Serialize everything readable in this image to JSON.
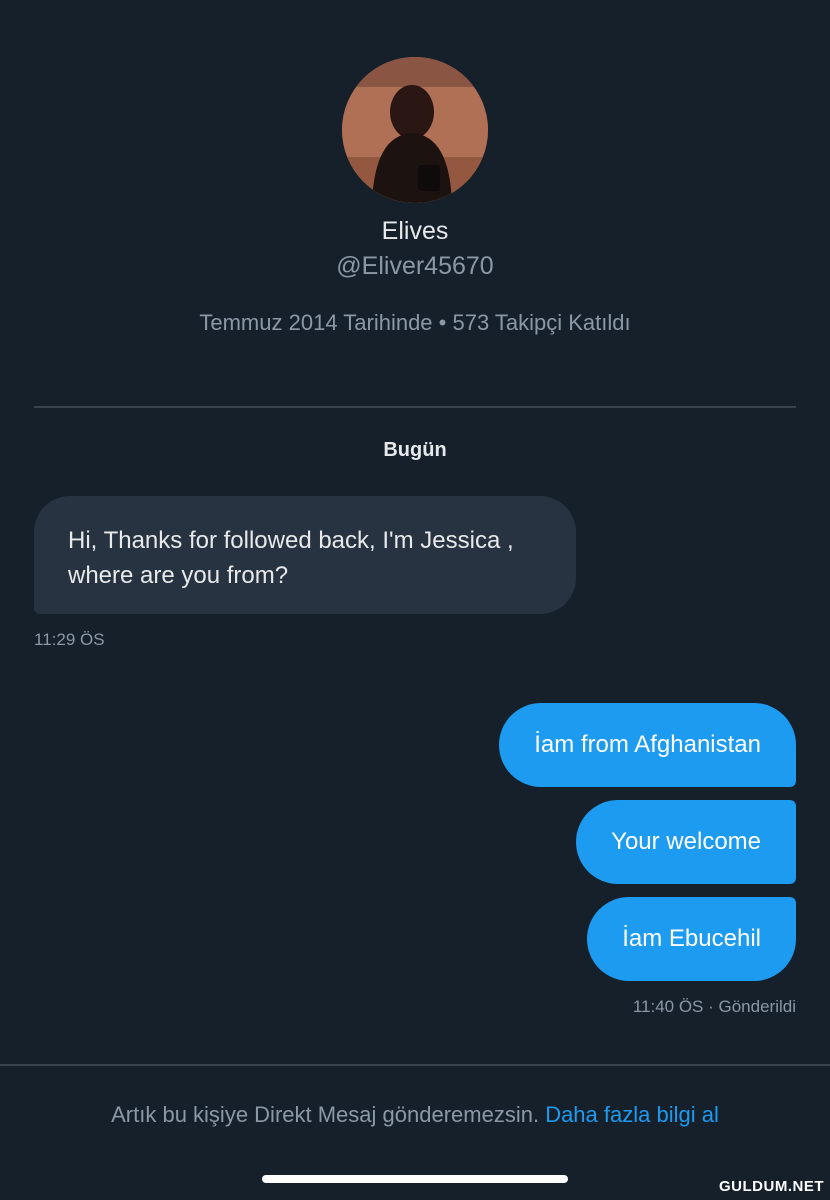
{
  "profile": {
    "display_name": "Elives",
    "handle": "@Eliver45670",
    "meta": "Temmuz 2014 Tarihinde • 573 Takipçi Katıldı"
  },
  "conversation": {
    "day_label": "Bugün",
    "incoming": {
      "text": "Hi, Thanks for followed back, I'm Jessica , where are you from?",
      "time": "11:29 ÖS"
    },
    "outgoing": [
      {
        "text": "İam from Afghanistan"
      },
      {
        "text": "Your welcome"
      },
      {
        "text": "İam Ebucehil"
      }
    ],
    "outgoing_status": "11:40 ÖS · Gönderildi"
  },
  "footer": {
    "notice": "Artık bu kişiye Direkt Mesaj gönderemezsin.",
    "link": "Daha fazla bilgi al"
  },
  "watermark": "GULDUM.NET",
  "colors": {
    "background": "#15202b",
    "accent": "#1d9bf0",
    "incoming_bubble": "#273340",
    "secondary_text": "#8b98a5"
  },
  "icons": {
    "avatar": "profile-photo"
  }
}
